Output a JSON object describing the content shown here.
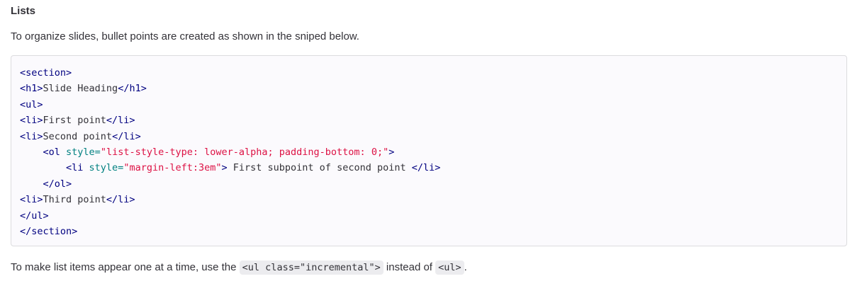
{
  "section": {
    "heading": "Lists",
    "intro": "To organize slides, bullet points are created as shown in the sniped below."
  },
  "code": {
    "lines": [
      [
        {
          "t": "tag",
          "v": "<section>"
        }
      ],
      [
        {
          "t": "tag",
          "v": "<h1>"
        },
        {
          "t": "txt",
          "v": "Slide Heading"
        },
        {
          "t": "tag",
          "v": "</h1>"
        }
      ],
      [
        {
          "t": "tag",
          "v": "<ul>"
        }
      ],
      [
        {
          "t": "tag",
          "v": "<li>"
        },
        {
          "t": "txt",
          "v": "First point"
        },
        {
          "t": "tag",
          "v": "</li>"
        }
      ],
      [
        {
          "t": "tag",
          "v": "<li>"
        },
        {
          "t": "txt",
          "v": "Second point"
        },
        {
          "t": "tag",
          "v": "</li>"
        }
      ],
      [
        {
          "t": "txt",
          "v": "    "
        },
        {
          "t": "tag",
          "v": "<ol "
        },
        {
          "t": "attr",
          "v": "style="
        },
        {
          "t": "str",
          "v": "\"list-style-type: lower-alpha; padding-bottom: 0;\""
        },
        {
          "t": "tag",
          "v": ">"
        }
      ],
      [
        {
          "t": "txt",
          "v": "        "
        },
        {
          "t": "tag",
          "v": "<li "
        },
        {
          "t": "attr",
          "v": "style="
        },
        {
          "t": "str",
          "v": "\"margin-left:3em\""
        },
        {
          "t": "tag",
          "v": ">"
        },
        {
          "t": "txt",
          "v": " First subpoint of second point "
        },
        {
          "t": "tag",
          "v": "</li>"
        }
      ],
      [
        {
          "t": "txt",
          "v": "    "
        },
        {
          "t": "tag",
          "v": "</ol>"
        }
      ],
      [
        {
          "t": "tag",
          "v": "<li>"
        },
        {
          "t": "txt",
          "v": "Third point"
        },
        {
          "t": "tag",
          "v": "</li>"
        }
      ],
      [
        {
          "t": "tag",
          "v": "</ul>"
        }
      ],
      [
        {
          "t": "tag",
          "v": "</section>"
        }
      ]
    ]
  },
  "outro": {
    "before": "To make list items appear one at a time, use the ",
    "code1": "<ul class=\"incremental\">",
    "middle": " instead of ",
    "code2": "<ul>",
    "after": "."
  },
  "colors": {
    "tag": "#000080",
    "attr": "#008080",
    "string": "#dd1144",
    "text": "#333238",
    "code_bg": "#fbfafd",
    "inline_code_bg": "#ececef"
  }
}
